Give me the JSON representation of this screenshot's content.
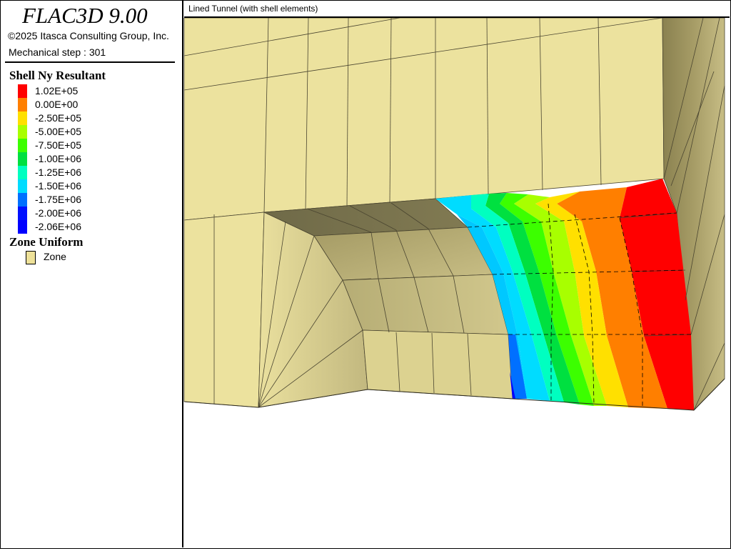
{
  "app": {
    "title": "FLAC3D 9.00",
    "copyright": "©2025 Itasca Consulting Group, Inc.",
    "step": "Mechanical step : 301"
  },
  "legend": {
    "shell": {
      "title": "Shell Ny Resultant",
      "entries": [
        {
          "color": "#ff0000",
          "label": "1.02E+05"
        },
        {
          "color": "#ff7f00",
          "label": "0.00E+00"
        },
        {
          "color": "#ffe000",
          "label": "-2.50E+05"
        },
        {
          "color": "#a8ff00",
          "label": "-5.00E+05"
        },
        {
          "color": "#3cff00",
          "label": "-7.50E+05"
        },
        {
          "color": "#00e040",
          "label": "-1.00E+06"
        },
        {
          "color": "#00ffc0",
          "label": "-1.25E+06"
        },
        {
          "color": "#00dcff",
          "label": "-1.50E+06"
        },
        {
          "color": "#0070ff",
          "label": "-1.75E+06"
        },
        {
          "color": "#0010ff",
          "label": "-2.00E+06"
        },
        {
          "color": "#0000ff",
          "label": "-2.06E+06"
        }
      ]
    },
    "zone": {
      "title": "Zone Uniform",
      "label": "Zone",
      "color": "#eee199"
    }
  },
  "view": {
    "title": "Lined Tunnel (with shell elements)"
  }
}
